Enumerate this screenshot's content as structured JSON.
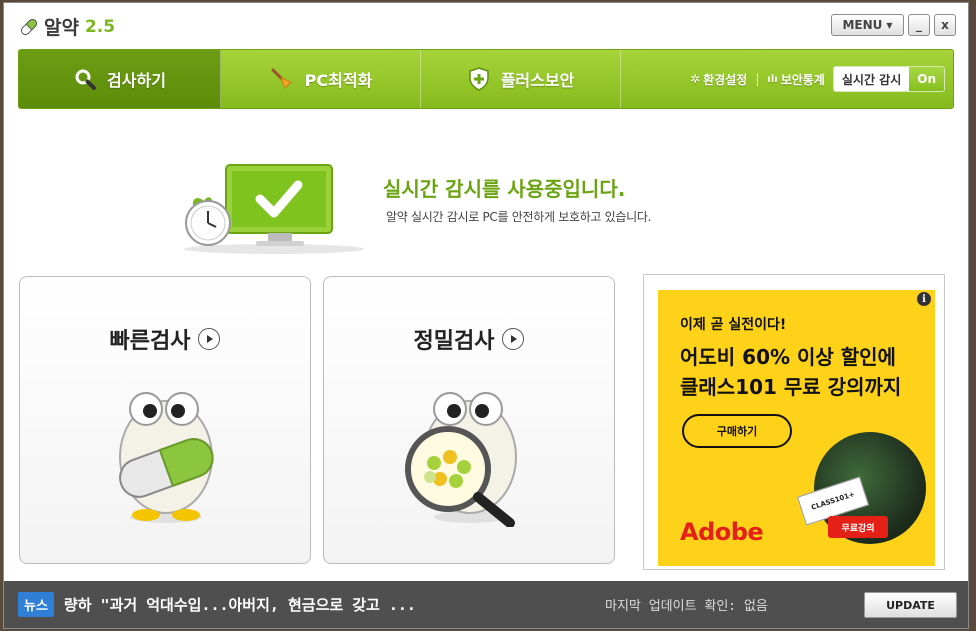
{
  "app": {
    "name": "알약",
    "version": "2.5"
  },
  "window_controls": {
    "menu_label": "MENU",
    "minimize_label": "_",
    "close_label": "x"
  },
  "nav": {
    "tabs": [
      {
        "label": "검사하기",
        "icon": "magnifier-icon",
        "active": true
      },
      {
        "label": "PC최적화",
        "icon": "broom-icon",
        "active": false
      },
      {
        "label": "플러스보안",
        "icon": "shield-plus-icon",
        "active": false
      }
    ],
    "settings_label": "환경설정",
    "stats_label": "보안통계",
    "realtime_label": "실시간 감시",
    "realtime_state": "On"
  },
  "status": {
    "title": "실시간 감시를 사용중입니다.",
    "subtitle": "알약 실시간 감시로 PC를 안전하게 보호하고 있습니다."
  },
  "scan_cards": [
    {
      "label": "빠른검사",
      "icon": "pill-mascot-icon"
    },
    {
      "label": "정밀검사",
      "icon": "magnifier-mascot-icon"
    }
  ],
  "ad": {
    "kicker": "이제 곧 실전이다!",
    "headline_line1": "어도비 60% 이상 할인에",
    "headline_line2": "클래스101 무료 강의까지",
    "button_label": "구매하기",
    "brand": "Adobe",
    "ticket_text": "CLASS101+",
    "tag_text": "무료강의",
    "info_label": "i"
  },
  "bottom": {
    "news_badge": "뉴스",
    "news_text": "량하 \"과거 억대수입...아버지, 현금으로 갖고 ...",
    "update_info": "마지막 업데이트 확인: 없음",
    "update_button": "UPDATE"
  },
  "colors": {
    "accent_green": "#86bb1c",
    "active_tab": "#5d8c0b",
    "ad_yellow": "#ffd21a",
    "adobe_red": "#e52017",
    "news_blue": "#2f7fd6"
  }
}
